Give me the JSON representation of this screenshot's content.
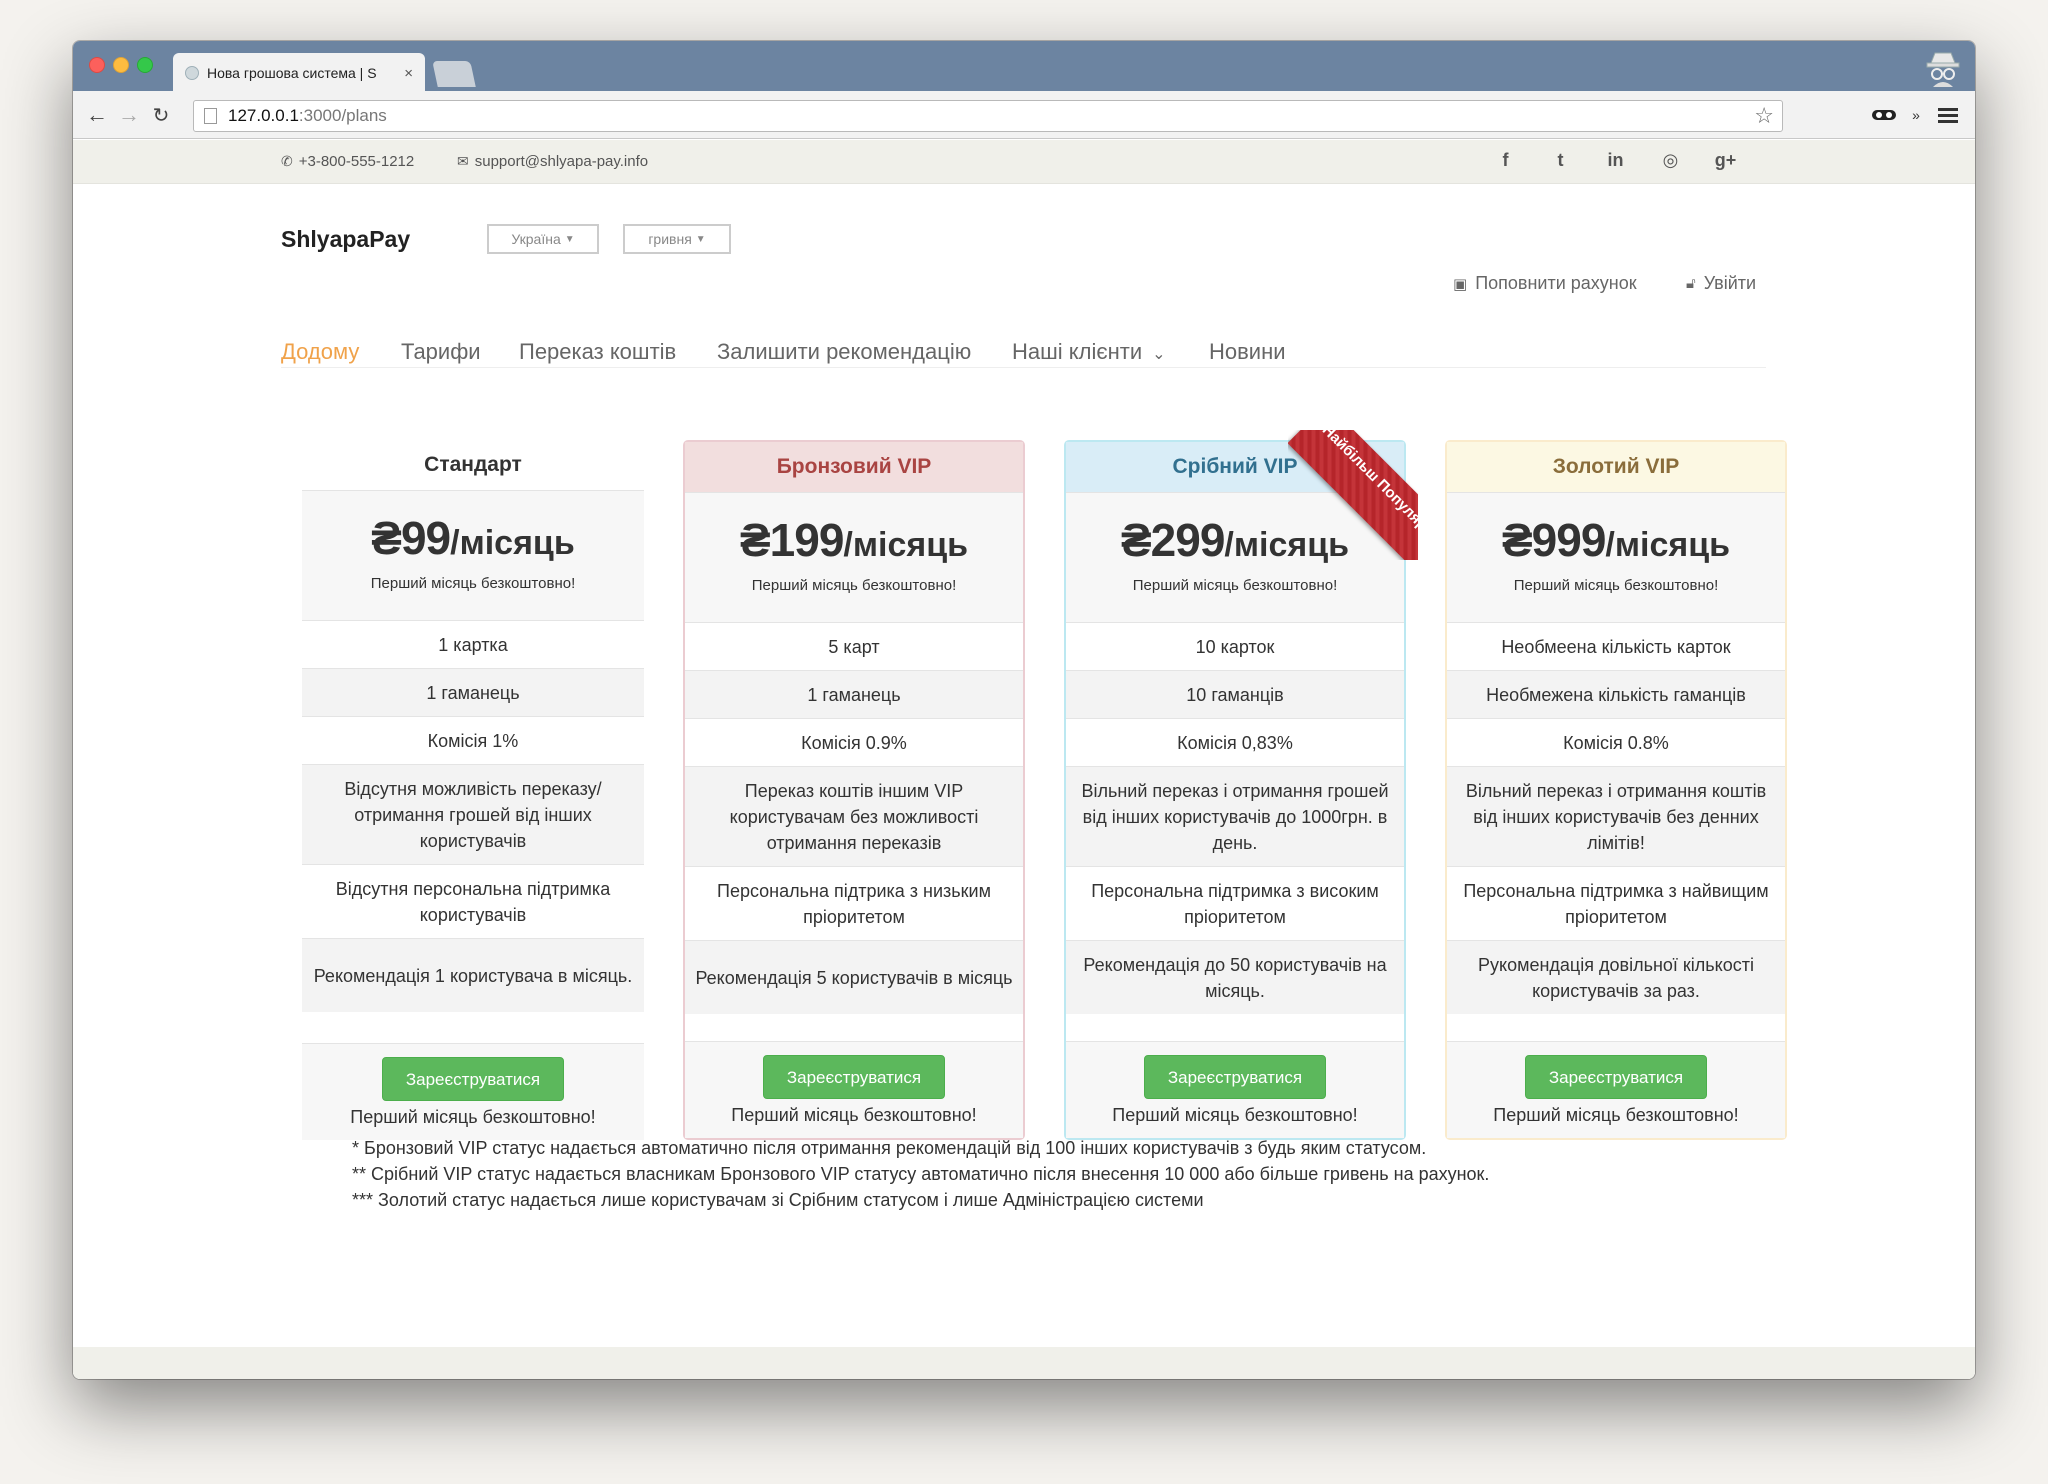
{
  "browser": {
    "tab_title": "Нова грошова система | S",
    "tab_close": "×",
    "url_host": "127.0.0.1",
    "url_path": ":3000/plans",
    "star": "☆",
    "more": "»"
  },
  "topbar": {
    "phone": "+3-800-555-1212",
    "email": "support@shlyapa-pay.info",
    "social": [
      "f",
      "t",
      "in",
      "◎",
      "g+"
    ]
  },
  "header": {
    "logo": "ShlyapaPay",
    "country_dropdown": "Україна",
    "currency_dropdown": "гривня",
    "topup_label": "Поповнити рахунок",
    "logout_label": "Увійти"
  },
  "nav": {
    "items": [
      "Додому",
      "Тарифи",
      "Переказ коштів",
      "Залишити рекомендацію",
      "Наші клієнти",
      "Новини"
    ]
  },
  "plans": [
    {
      "name": "Стандарт",
      "price": "₴99",
      "period": "/місяць",
      "price_note": "Перший місяць безкоштовно!",
      "features": [
        "1 картка",
        "1 гаманець",
        "Комісія 1%",
        "Відсутня можливість переказу/ отримання грошей від інших користувачів",
        "Відсутня персональна підтримка користувачів",
        "Рекомендація 1 користувача в місяць."
      ],
      "button": "Зареєструватися",
      "footer_note": "Перший місяць безкоштовно!",
      "head_bg": "#ffffff",
      "head_color": "#222222",
      "border": "none"
    },
    {
      "name": "Бронзовий VIP",
      "price": "₴199",
      "period": "/місяць",
      "price_note": "Перший місяць безкоштовно!",
      "features": [
        "5 карт",
        "1 гаманець",
        "Комісія 0.9%",
        "Переказ коштів іншим VIP користувачам без можливості отримання переказів",
        "Персональна підтрика з низьким пріоритетом",
        "Рекомендація 5 користувачів в місяць"
      ],
      "button": "Зареєструватися",
      "footer_note": "Перший місяць безкоштовно!",
      "head_bg": "#f2dede",
      "head_color": "#a94442",
      "border": "#ebccd1"
    },
    {
      "name": "Срібний VIP",
      "price": "₴299",
      "period": "/місяць",
      "price_note": "Перший місяць безкоштовно!",
      "features": [
        "10 карток",
        "10 гаманців",
        "Комісія 0,83%",
        "Вільний переказ і отримання грошей від інших користувачів до 1000грн. в день.",
        "Персональна підтримка з високим пріоритетом",
        "Рекомендація до 50 користувачів на місяць."
      ],
      "button": "Зареєструватися",
      "footer_note": "Перший місяць безкоштовно!",
      "head_bg": "#d9edf7",
      "head_color": "#31708f",
      "border": "#bce8f1",
      "ribbon": "Найбільш Популярний"
    },
    {
      "name": "Золотий VIP",
      "price": "₴999",
      "period": "/місяць",
      "price_note": "Перший місяць безкоштовно!",
      "features": [
        "Необмеена кількість карток",
        "Необмежена кількість гаманців",
        "Комісія 0.8%",
        "Вільний переказ і отримання коштів від інших користувачів без денних лімітів!",
        "Персональна підтримка з найвищим пріоритетом",
        "Рукомендація довільної кількості користувачів за раз."
      ],
      "button": "Зареєструватися",
      "footer_note": "Перший місяць безкоштовно!",
      "head_bg": "#fcf8e3",
      "head_color": "#8a6d3b",
      "border": "#faebcc"
    }
  ],
  "footnotes": [
    "* Бронзовий VIP статус надається автоматично після отримання рекомендацій від 100 інших користувачів з будь яким статусом.",
    "** Срібний VIP статус надається власникам Бронзового VIP статусу автоматично після внесення 10 000 або більше гривень на рахунок.",
    "*** Золотий статус надається лише користувачам зі Срібним статусом і лише Адміністрацією системи"
  ]
}
